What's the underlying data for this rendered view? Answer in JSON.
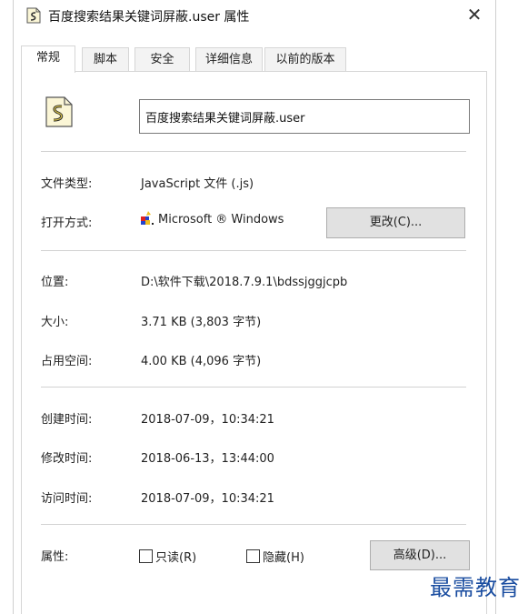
{
  "window": {
    "title": "百度搜索结果关键词屏蔽.user 属性",
    "close_glyph": "✕"
  },
  "tabs": [
    {
      "label": "常规",
      "active": true
    },
    {
      "label": "脚本",
      "active": false
    },
    {
      "label": "安全",
      "active": false
    },
    {
      "label": "详细信息",
      "active": false
    },
    {
      "label": "以前的版本",
      "active": false
    }
  ],
  "general": {
    "file_name": "百度搜索结果关键词屏蔽.user",
    "file_icon": "script-file-icon",
    "type_label": "文件类型:",
    "type_value": "JavaScript 文件 (.js)",
    "open_with_label": "打开方式:",
    "open_with_value": "Microsoft ® Windows",
    "open_with_icon": "windows-script-host-icon",
    "change_button": "更改(C)...",
    "location_label": "位置:",
    "location_value": "D:\\软件下载\\2018.7.9.1\\bdssjggjcpb",
    "size_label": "大小:",
    "size_value": "3.71 KB (3,803 字节)",
    "disk_size_label": "占用空间:",
    "disk_size_value": "4.00 KB (4,096 字节)",
    "created_label": "创建时间:",
    "created_value": "2018-07-09，10:34:21",
    "modified_label": "修改时间:",
    "modified_value": "2018-06-13，13:44:00",
    "accessed_label": "访问时间:",
    "accessed_value": "2018-07-09，10:34:21",
    "attributes_label": "属性:",
    "readonly_label": "只读(R)",
    "readonly_checked": false,
    "hidden_label": "隐藏(H)",
    "hidden_checked": false,
    "advanced_button": "高级(D)..."
  },
  "watermark": "最需教育",
  "colors": {
    "accent": "#1a4da0",
    "button_bg": "#e1e1e1",
    "separator": "#d2d2d2"
  }
}
